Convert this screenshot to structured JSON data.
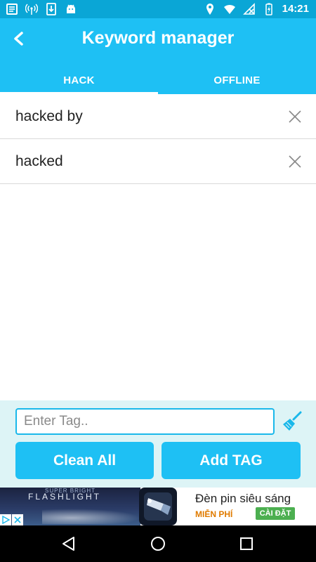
{
  "status_bar": {
    "time": "14:21",
    "left_icons": [
      "notification-list-icon",
      "wireless-icon",
      "download-icon",
      "android-icon"
    ],
    "right_icons": [
      "location-icon",
      "wifi-icon",
      "no-signal-icon",
      "battery-charging-icon"
    ]
  },
  "header": {
    "title": "Keyword manager",
    "back_icon": "chevron-left-icon",
    "tabs": [
      {
        "label": "HACK",
        "active": true
      },
      {
        "label": "OFFLINE",
        "active": false
      }
    ]
  },
  "keywords": [
    {
      "text": "hacked by"
    },
    {
      "text": "hacked"
    }
  ],
  "input": {
    "placeholder": "Enter Tag..",
    "value": ""
  },
  "buttons": {
    "clean_all": "Clean All",
    "add_tag": "Add TAG"
  },
  "ad": {
    "small_text": "SUPER BRIGHT",
    "brand": "FLASHLIGHT",
    "title": "Đèn pin siêu sáng",
    "free_label": "MIỄN PHÍ",
    "install_label": "CÀI ĐẶT"
  },
  "colors": {
    "accent": "#1ec0f4",
    "status_bar": "#0aa6d6",
    "panel": "#ddf4f6"
  }
}
